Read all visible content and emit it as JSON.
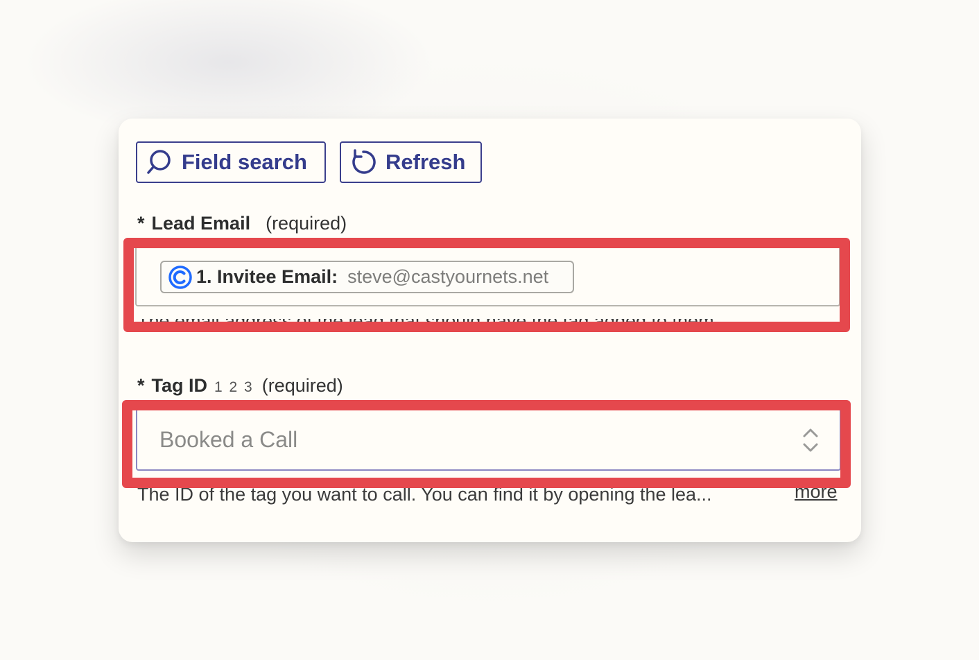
{
  "toolbar": {
    "field_search_label": "Field search",
    "refresh_label": "Refresh"
  },
  "lead_email": {
    "asterisk": "*",
    "label": "Lead Email",
    "required_text": "(required)",
    "chip_key": "1. Invitee Email:",
    "chip_value": "steve@castyournets.net",
    "hint": "The email address of the lead that should have the tag added to them."
  },
  "tag_id": {
    "asterisk": "*",
    "label": "Tag ID",
    "type_hint": "1 2 3",
    "required_text": "(required)",
    "value": "Booked a Call",
    "hint": "The ID of the tag you want to call. You can find it by opening the lea...",
    "more_label": "more"
  },
  "colors": {
    "accent": "#343c8c",
    "highlight": "#e5484d",
    "chip_logo": "#1f6bff"
  }
}
